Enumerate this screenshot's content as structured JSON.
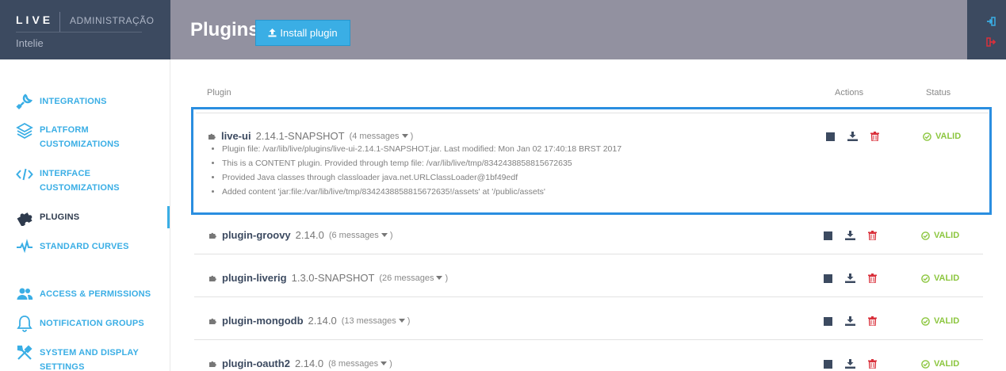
{
  "brand": {
    "logo": "LIVE",
    "section": "ADMINISTRAÇÃO",
    "org": "Intelie"
  },
  "header": {
    "title": "Plugins",
    "install_label": "Install plugin"
  },
  "sidebar": {
    "items": [
      {
        "line1": "INTEGRATIONS",
        "line2": "",
        "icon": "wrench-plug-icon"
      },
      {
        "line1": "PLATFORM",
        "line2": "CUSTOMIZATIONS",
        "icon": "layers-icon"
      },
      {
        "line1": "INTERFACE",
        "line2": "CUSTOMIZATIONS",
        "icon": "code-icon"
      },
      {
        "line1": "PLUGINS",
        "line2": "",
        "icon": "puzzle-icon"
      },
      {
        "line1": "STANDARD CURVES",
        "line2": "",
        "icon": "pulse-icon"
      },
      {
        "line1": "ACCESS & PERMISSIONS",
        "line2": "",
        "icon": "users-icon"
      },
      {
        "line1": "NOTIFICATION GROUPS",
        "line2": "",
        "icon": "bell-icon"
      },
      {
        "line1": "SYSTEM AND DISPLAY",
        "line2": "SETTINGS",
        "icon": "tools-icon"
      }
    ],
    "active": "PLUGINS"
  },
  "table": {
    "col_plugin": "Plugin",
    "col_actions": "Actions",
    "col_status": "Status"
  },
  "plugins": [
    {
      "name": "live-ui",
      "version": "2.14.1-SNAPSHOT",
      "messages": "(4 messages",
      "close": ")",
      "status": "VALID",
      "details": [
        "Plugin file: /var/lib/live/plugins/live-ui-2.14.1-SNAPSHOT.jar. Last modified: Mon Jan 02 17:40:18 BRST 2017",
        "This is a CONTENT plugin. Provided through temp file: /var/lib/live/tmp/8342438858815672635",
        "Provided Java classes through classloader java.net.URLClassLoader@1bf49edf",
        "Added content 'jar:file:/var/lib/live/tmp/8342438858815672635!/assets' at '/public/assets'"
      ]
    },
    {
      "name": "plugin-groovy",
      "version": "2.14.0",
      "messages": "(6 messages",
      "close": ")",
      "status": "VALID"
    },
    {
      "name": "plugin-liverig",
      "version": "1.3.0-SNAPSHOT",
      "messages": "(26 messages",
      "close": ")",
      "status": "VALID"
    },
    {
      "name": "plugin-mongodb",
      "version": "2.14.0",
      "messages": "(13 messages",
      "close": ")",
      "status": "VALID"
    },
    {
      "name": "plugin-oauth2",
      "version": "2.14.0",
      "messages": "(8 messages",
      "close": ")",
      "status": "VALID"
    }
  ],
  "colors": {
    "accent": "#3aaee5",
    "valid": "#8cc63f",
    "delete": "#d9303b",
    "dark": "#3c4a60"
  }
}
